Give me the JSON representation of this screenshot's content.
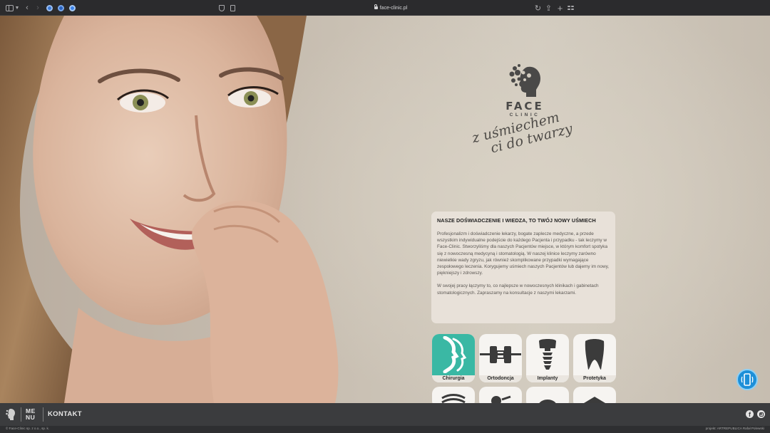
{
  "browser": {
    "url": "face-clinic.pl"
  },
  "hero": {
    "logo_word1": "FACE",
    "logo_word2": "CLINIC",
    "tagline_line1": "z uśmiechem",
    "tagline_line2": "ci do twarzy"
  },
  "info": {
    "title": "NASZE DOŚWIADCZENIE I WIEDZA, TO TWÓJ NOWY UŚMIECH",
    "paragraph1": "Profesjonalizm i doświadczenie lekarzy, bogate zaplecze medyczne, a przede wszystkim indywidualne podejście do każdego Pacjenta i przypadku - tak leczymy w Face-Clinic. Stworzyliśmy dla naszych Pacjentów miejsce, w którym komfort spotyka się z nowoczesną medycyną i stomatologią. W naszej klinice leczymy zarówno niewielkie wady zgryzu, jak również skomplikowane przypadki wymagające zespołowego leczenia. Korygujemy uśmiech naszych Pacjentów lub dajemy im nowy, piękniejszy i zdrowszy.",
    "paragraph2": "W swojej pracy łączymy to, co najlepsze w nowoczesnych klinikach i gabinetach stomatologicznych. Zapraszamy na konsultacje z naszymi lekarzami."
  },
  "services": [
    {
      "label": "Chirurgia",
      "icon": "face-profile-icon",
      "active": true
    },
    {
      "label": "Ortodoncja",
      "icon": "braces-icon",
      "active": false
    },
    {
      "label": "Implanty",
      "icon": "implant-icon",
      "active": false
    },
    {
      "label": "Protetyka",
      "icon": "crown-icon",
      "active": false
    }
  ],
  "footer": {
    "menu_line1": "ME",
    "menu_line2": "NU",
    "contact_label": "KONTAKT",
    "copyright": "© Face-Clinic sp. z o.o., sp. k.",
    "credit": "projekt: ARTREPUBLICA Rafał Polewski"
  },
  "colors": {
    "accent_teal": "#3ab8a4",
    "footer_bg": "#3b3c3e",
    "call_button": "#1d8fd8"
  }
}
